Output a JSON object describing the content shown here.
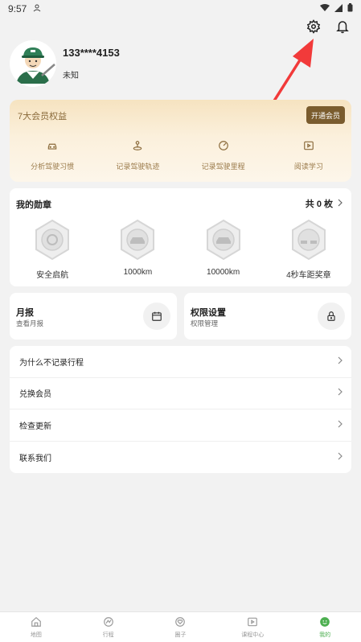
{
  "status_bar": {
    "time": "9:57"
  },
  "profile": {
    "phone": "133****4153",
    "gender": "未知"
  },
  "vip": {
    "title": "7大会员权益",
    "button": "开通会员",
    "items": [
      {
        "label": "分析驾驶习惯",
        "icon": "car-icon"
      },
      {
        "label": "记录驾驶轨迹",
        "icon": "route-icon"
      },
      {
        "label": "记录驾驶里程",
        "icon": "speedometer-icon"
      },
      {
        "label": "阅读学习",
        "icon": "play-icon"
      }
    ]
  },
  "medals": {
    "title": "我的勋章",
    "count": "共 0 枚",
    "items": [
      {
        "name": "安全启航"
      },
      {
        "name": "1000km"
      },
      {
        "name": "10000km"
      },
      {
        "name": "4秒车距奖章"
      }
    ]
  },
  "report": {
    "title": "月报",
    "subtitle": "查看月报"
  },
  "permissions": {
    "title": "权限设置",
    "subtitle": "权限管理"
  },
  "menu": [
    {
      "label": "为什么不记录行程"
    },
    {
      "label": "兑换会员"
    },
    {
      "label": "检查更新"
    },
    {
      "label": "联系我们"
    }
  ],
  "tabs": [
    {
      "label": "地图",
      "icon": "home-icon"
    },
    {
      "label": "行程",
      "icon": "trips-icon"
    },
    {
      "label": "圈子",
      "icon": "heart-icon"
    },
    {
      "label": "课程中心",
      "icon": "video-icon"
    },
    {
      "label": "我的",
      "icon": "smile-icon"
    }
  ],
  "colors": {
    "accent": "#4caf50",
    "vip_button": "#7a5c2e",
    "annotation_arrow": "#f23a3a"
  }
}
